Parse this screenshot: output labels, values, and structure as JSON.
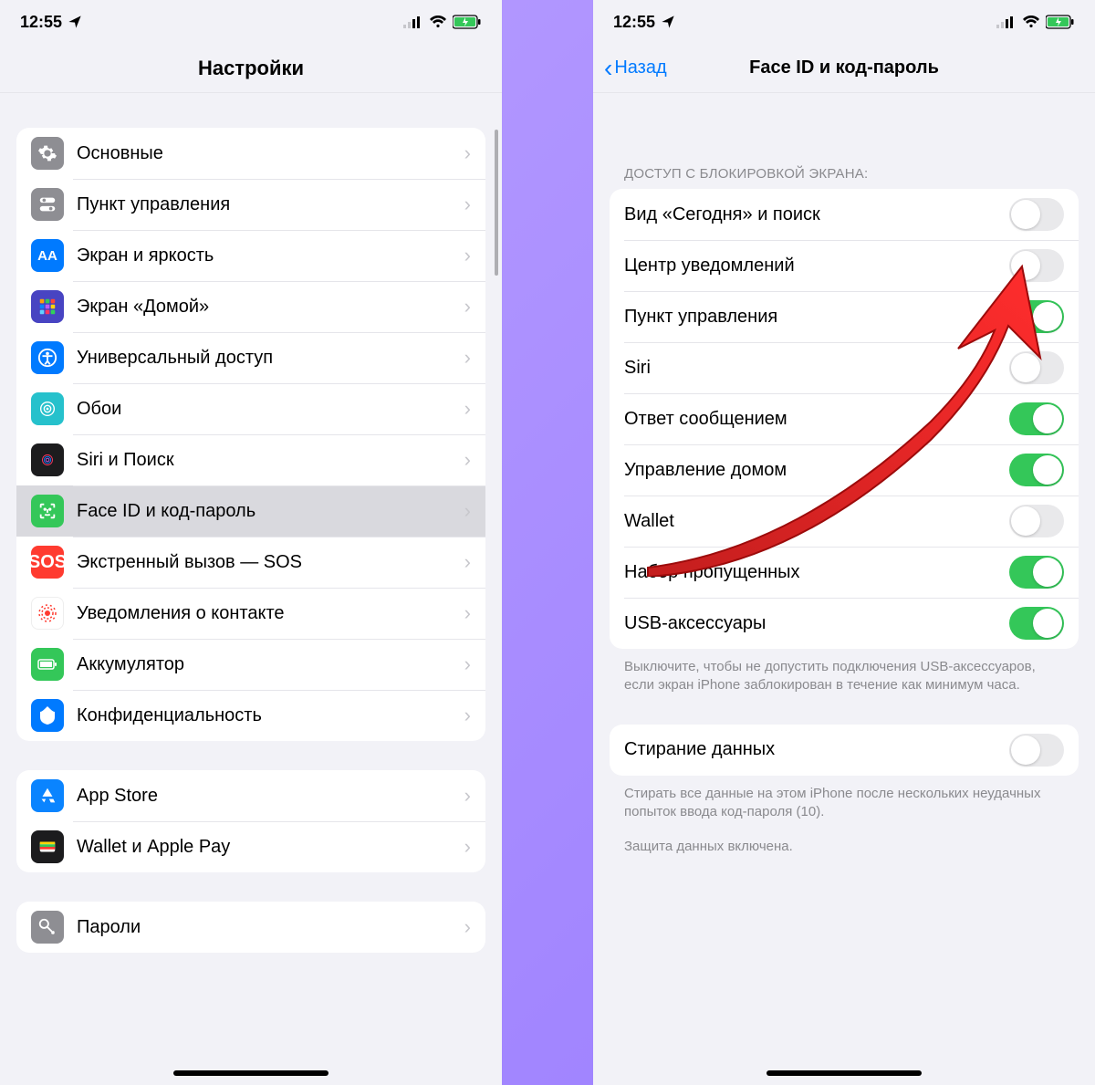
{
  "status": {
    "time": "12:55"
  },
  "left": {
    "title": "Настройки",
    "group1": [
      {
        "key": "general",
        "label": "Основные"
      },
      {
        "key": "control",
        "label": "Пункт управления"
      },
      {
        "key": "display",
        "label": "Экран и яркость"
      },
      {
        "key": "home",
        "label": "Экран «Домой»"
      },
      {
        "key": "access",
        "label": "Универсальный доступ"
      },
      {
        "key": "wallpaper",
        "label": "Обои"
      },
      {
        "key": "siri",
        "label": "Siri и Поиск"
      },
      {
        "key": "faceid",
        "label": "Face ID и код-пароль",
        "selected": true
      },
      {
        "key": "sos",
        "label": "Экстренный вызов — SOS"
      },
      {
        "key": "exposure",
        "label": "Уведомления о контакте"
      },
      {
        "key": "battery",
        "label": "Аккумулятор"
      },
      {
        "key": "privacy",
        "label": "Конфиденциальность"
      }
    ],
    "group2": [
      {
        "key": "appstore",
        "label": "App Store"
      },
      {
        "key": "wallet",
        "label": "Wallet и Apple Pay"
      }
    ],
    "group3_peek": "Пароли"
  },
  "right": {
    "back": "Назад",
    "title": "Face ID и код-пароль",
    "section_header": "ДОСТУП С БЛОКИРОВКОЙ ЭКРАНА:",
    "toggles": [
      {
        "key": "today",
        "label": "Вид «Сегодня» и поиск",
        "on": false
      },
      {
        "key": "notif",
        "label": "Центр уведомлений",
        "on": false
      },
      {
        "key": "control",
        "label": "Пункт управления",
        "on": true
      },
      {
        "key": "siri",
        "label": "Siri",
        "on": false
      },
      {
        "key": "reply",
        "label": "Ответ сообщением",
        "on": true
      },
      {
        "key": "homectl",
        "label": "Управление домом",
        "on": true
      },
      {
        "key": "wallet",
        "label": "Wallet",
        "on": false
      },
      {
        "key": "return",
        "label": "Набор пропущенных",
        "on": true
      },
      {
        "key": "usb",
        "label": "USB-аксессуары",
        "on": true
      }
    ],
    "usb_footer": "Выключите, чтобы не допустить подключения USB-аксессуаров, если экран iPhone заблокирован в течение как минимум часа.",
    "erase": {
      "label": "Стирание данных",
      "on": false
    },
    "erase_footer1": "Стирать все данные на этом iPhone после нескольких неудачных попыток ввода код-пароля (10).",
    "erase_footer2": "Защита данных включена."
  }
}
